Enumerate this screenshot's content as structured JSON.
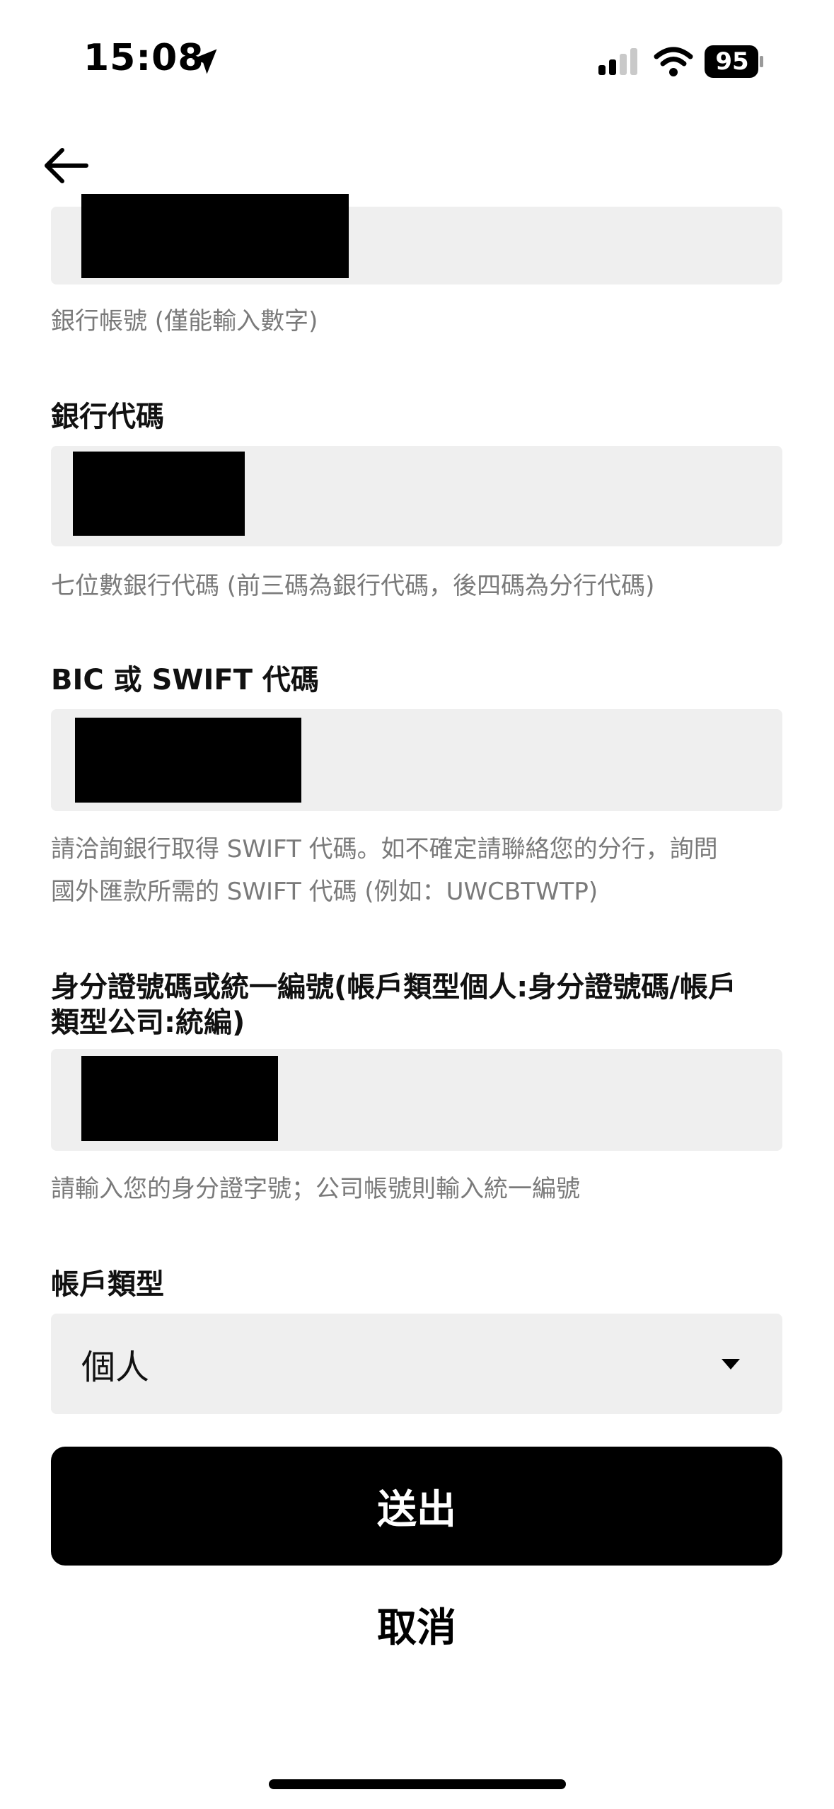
{
  "status_bar": {
    "time": "15:08",
    "battery": "95",
    "icons": [
      "location-arrow-icon",
      "signal-icon",
      "wifi-icon",
      "battery-icon"
    ]
  },
  "nav": {
    "back_icon": "back-arrow-icon"
  },
  "fields": {
    "bank_account": {
      "helper": "銀行帳號 (僅能輸入數字)"
    },
    "bank_code": {
      "label": "銀行代碼",
      "helper": "七位數銀行代碼 (前三碼為銀行代碼，後四碼為分行代碼)"
    },
    "swift": {
      "label": "BIC 或 SWIFT 代碼",
      "helper_line1": "請洽詢銀行取得 SWIFT 代碼。如不確定請聯絡您的分行，詢問",
      "helper_line2": "國外匯款所需的 SWIFT 代碼 (例如：UWCBTWTP)"
    },
    "id_number": {
      "label_line1": "身分證號碼或統一編號(帳戶類型個人:身分證號碼/帳戶",
      "label_line2": "類型公司:統編)",
      "helper": "請輸入您的身分證字號；公司帳號則輸入統一編號"
    },
    "account_type": {
      "label": "帳戶類型",
      "value": "個人"
    }
  },
  "actions": {
    "submit": "送出",
    "cancel": "取消"
  }
}
